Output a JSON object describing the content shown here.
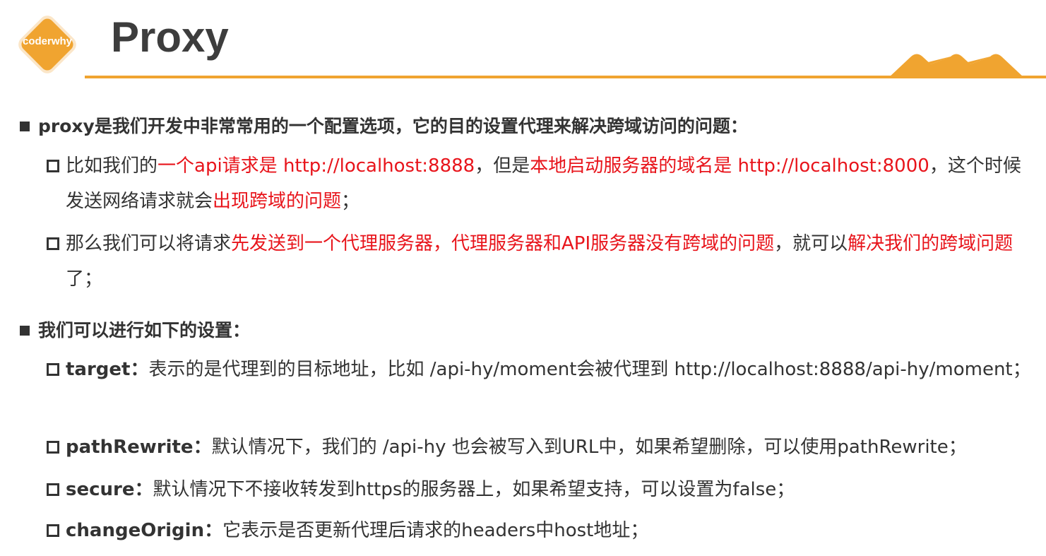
{
  "logo": {
    "text": "coderwhy",
    "color": "#f0a430"
  },
  "title": "Proxy",
  "sections": [
    {
      "heading": "proxy是我们开发中非常常用的一个配置选项，它的目的设置代理来解决跨域访问的问题：",
      "items": [
        {
          "parts": [
            "比如我们的",
            "一个api请求是 http://localhost:8888",
            "，但是",
            "本地启动服务器的域名是 http://localhost:8000",
            "，这个时候发送网络请求就会",
            "出现跨域的问题",
            "；"
          ]
        },
        {
          "parts": [
            "那么我们可以将请求",
            "先发送到一个代理服务器，代理服务器和API服务器没有跨域的问题",
            "，就可以",
            "解决我们的跨域问题",
            "了；"
          ]
        }
      ]
    },
    {
      "heading": "我们可以进行如下的设置：",
      "items": [
        {
          "key": "target：",
          "text": "表示的是代理到的目标地址，比如 /api-hy/moment会被代理到 http://localhost:8888/api-hy/moment；"
        },
        {
          "key": "pathRewrite：",
          "text": "默认情况下，我们的 /api-hy 也会被写入到URL中，如果希望删除，可以使用pathRewrite；"
        },
        {
          "key": "secure：",
          "text": "默认情况下不接收转发到https的服务器上，如果希望支持，可以设置为false；"
        },
        {
          "key": "changeOrigin：",
          "text": "它表示是否更新代理后请求的headers中host地址；"
        }
      ]
    }
  ],
  "colors": {
    "accent": "#f0a430",
    "highlight": "#e8141b",
    "text": "#333333"
  }
}
